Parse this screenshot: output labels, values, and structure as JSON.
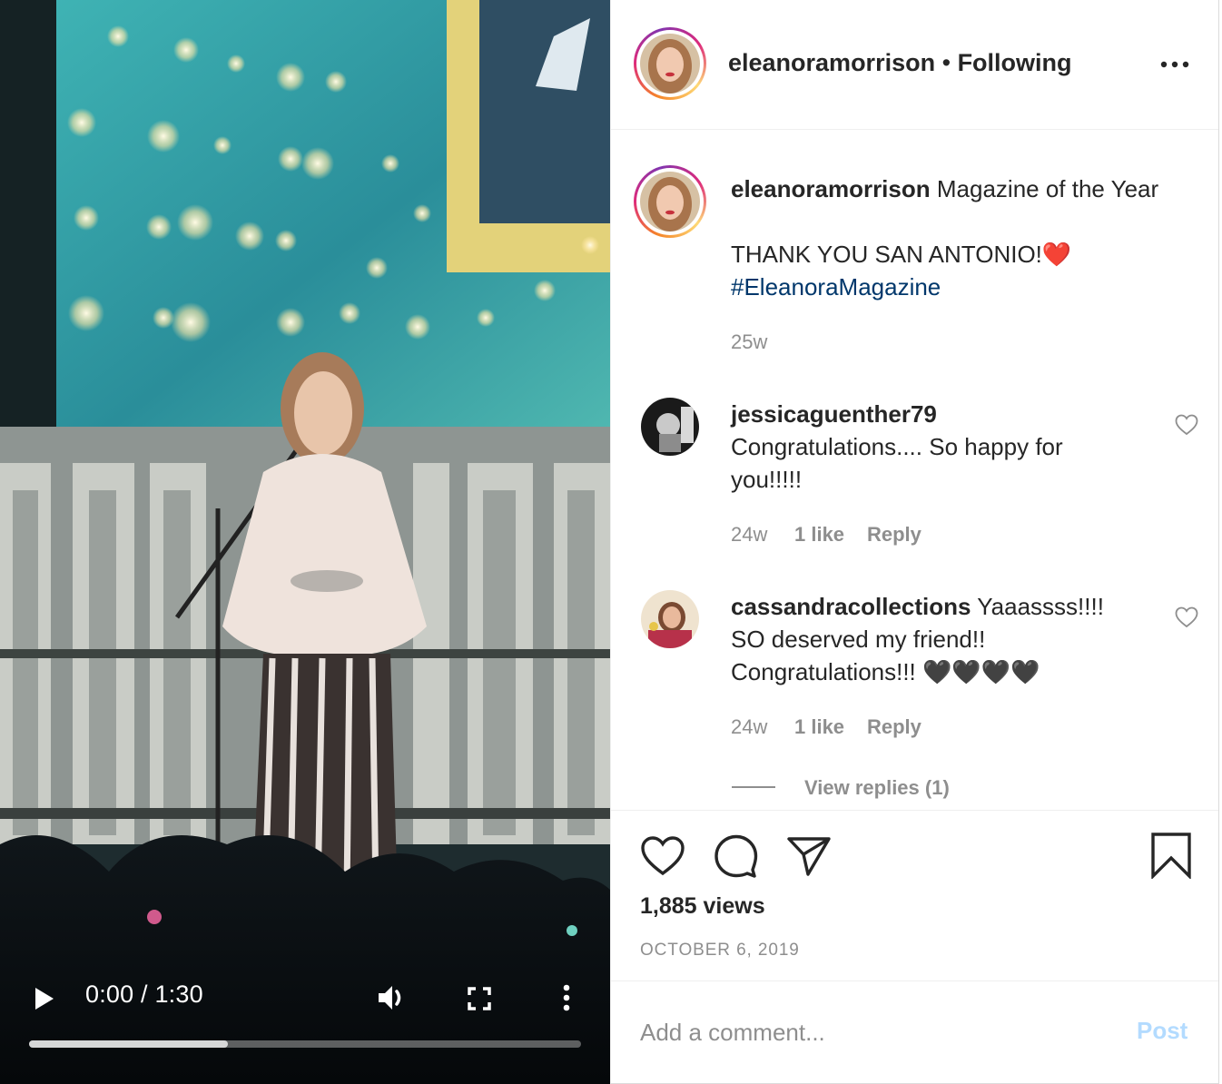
{
  "video": {
    "time_label": "0:00 / 1:30",
    "progress_buffered": 0.36,
    "icons": [
      "play-icon",
      "volume-icon",
      "fullscreen-icon",
      "more-vertical-icon"
    ]
  },
  "header": {
    "username": "eleanoramorrison",
    "separator": "•",
    "follow_status": "Following"
  },
  "caption": {
    "username": "eleanoramorrison",
    "text_line1": "Magazine of the Year",
    "text_line2": "THANK YOU SAN ANTONIO!",
    "emoji": "❤️",
    "hashtag": "#EleanoraMagazine",
    "age": "25w"
  },
  "comments": [
    {
      "username": "jessicaguenther79",
      "line1": "Congratulations.... So happy for",
      "line2": "you!!!!!",
      "age": "24w",
      "likes": "1 like",
      "reply": "Reply"
    },
    {
      "username": "cassandracollections",
      "line1": "Yaaassss!!!!",
      "line2": "SO deserved my friend!!",
      "line3": "Congratulations!!! 🖤🖤🖤🖤",
      "age": "24w",
      "likes": "1 like",
      "reply": "Reply",
      "view_replies": "View replies (1)"
    }
  ],
  "actions": {
    "views": "1,885 views",
    "date": "OCTOBER 6, 2019"
  },
  "composer": {
    "placeholder": "Add a comment...",
    "post_label": "Post"
  },
  "colors": {
    "link": "#00376b",
    "muted": "#8e8e8e",
    "post_disabled": "#b3dbff",
    "text": "#262626"
  }
}
